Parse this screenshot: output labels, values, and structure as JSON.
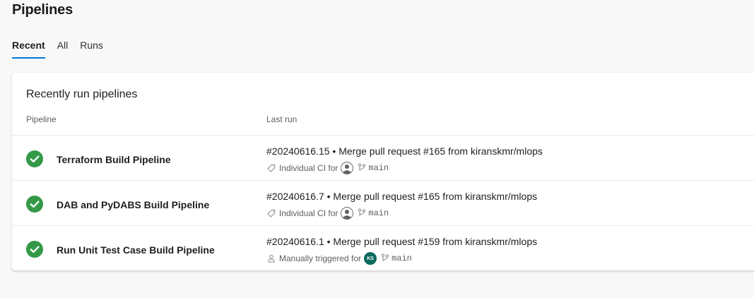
{
  "page": {
    "title": "Pipelines"
  },
  "tabs": [
    {
      "label": "Recent",
      "selected": true
    },
    {
      "label": "All",
      "selected": false
    },
    {
      "label": "Runs",
      "selected": false
    }
  ],
  "card": {
    "title": "Recently run pipelines",
    "columns": {
      "pipeline": "Pipeline",
      "last_run": "Last run"
    },
    "rows": [
      {
        "status": "succeeded",
        "status_icon": "check-circle-icon",
        "name": "Terraform Build Pipeline",
        "run_title": "#20240616.15 • Merge pull request #165 from kiranskmr/mlops",
        "trigger_icon": "tag-icon",
        "trigger": "Individual CI for",
        "avatar": {
          "type": "generic",
          "initials": ""
        },
        "branch": "main"
      },
      {
        "status": "succeeded",
        "status_icon": "check-circle-icon",
        "name": "DAB and PyDABS Build Pipeline",
        "run_title": "#20240616.7 • Merge pull request #165 from kiranskmr/mlops",
        "trigger_icon": "tag-icon",
        "trigger": "Individual CI for",
        "avatar": {
          "type": "generic",
          "initials": ""
        },
        "branch": "main"
      },
      {
        "status": "succeeded",
        "status_icon": "check-circle-icon",
        "name": "Run Unit Test Case Build Pipeline",
        "run_title": "#20240616.1 • Merge pull request #159 from kiranskmr/mlops",
        "trigger_icon": "person-icon",
        "trigger": "Manually triggered for",
        "avatar": {
          "type": "initials",
          "initials": "KS"
        },
        "branch": "main"
      }
    ]
  },
  "colors": {
    "accent": "#0078d4",
    "success": "#339947",
    "avatar_initials_bg": "#0b6a5c"
  }
}
